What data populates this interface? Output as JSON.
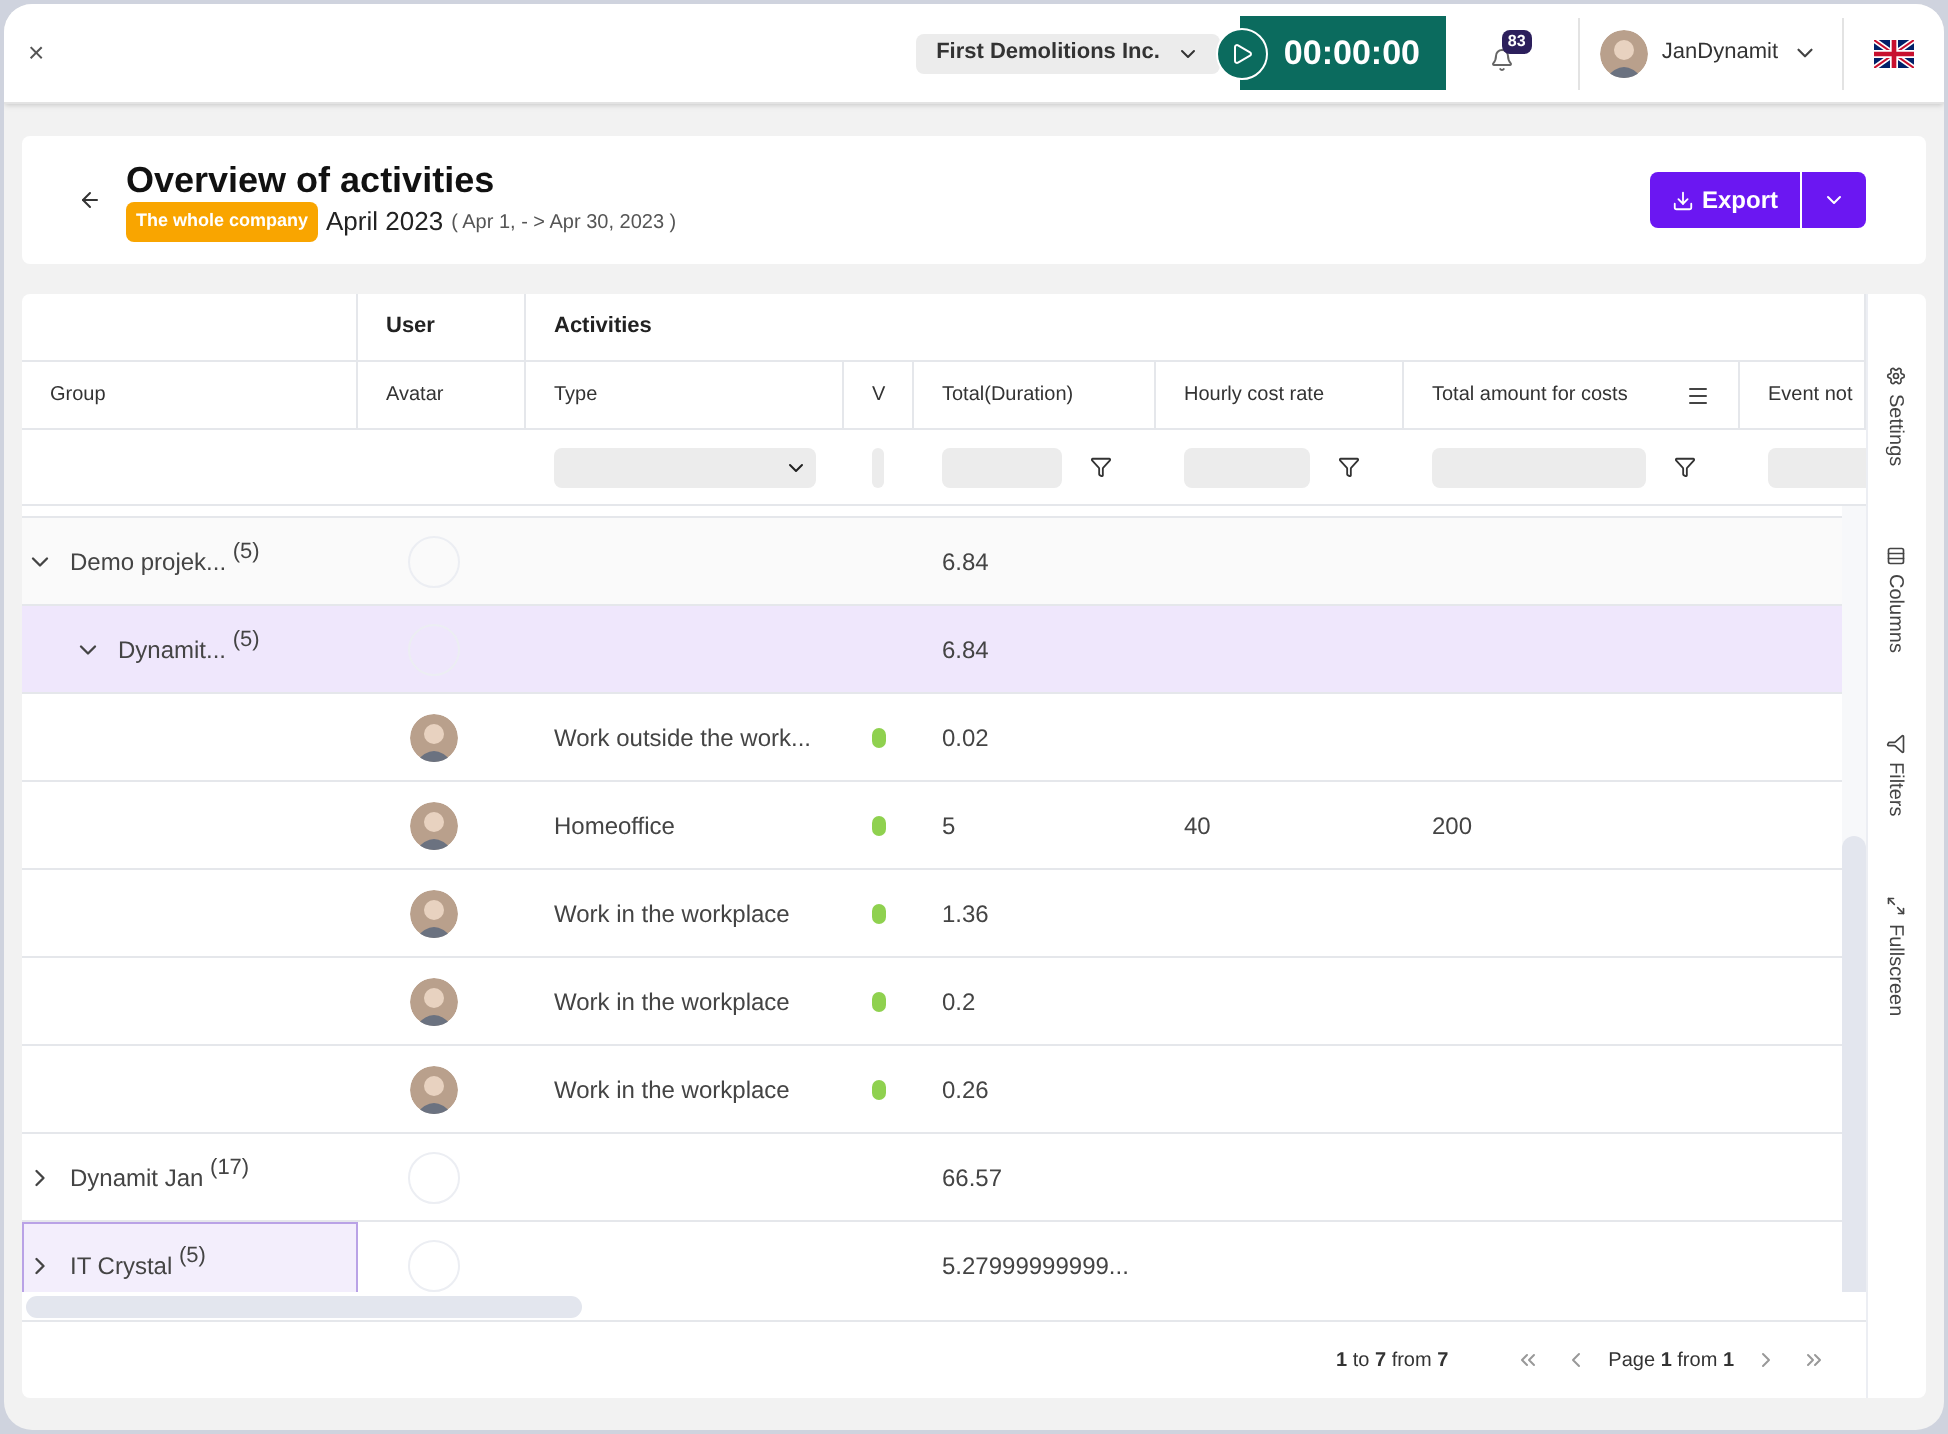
{
  "topbar": {
    "close": "×",
    "company": "First Demolitions Inc.",
    "timer": "00:00:00",
    "notifications": "83",
    "user": "JanDynamit"
  },
  "header": {
    "title": "Overview of activities",
    "scope_badge": "The whole company",
    "period": "April 2023",
    "range": "( Apr 1, - > Apr 30, 2023 )",
    "export": "Export"
  },
  "table": {
    "group_headers": [
      "User",
      "Activities"
    ],
    "columns": [
      "Group",
      "Avatar",
      "Type",
      "V",
      "Total(Duration)",
      "Hourly cost rate",
      "Total amount for costs",
      "Event not"
    ],
    "rows": [
      {
        "kind": "group",
        "label": "Demo projek... $^{(5)}$",
        "total": "6.84",
        "expanded": true,
        "selected": false,
        "focused": false,
        "children": [
          {
            "kind": "group",
            "label": "Dynamit... $^{(5)}$",
            "total": "6.84",
            "expanded": true,
            "selected": true,
            "focused": false,
            "children": [
              {
                "kind": "activity",
                "type": "Work outside the work...",
                "color": "#8fd14f",
                "total": "0.02"
              },
              {
                "kind": "activity",
                "type": "Homeoffice",
                "color": "#8fd14f",
                "total": "5",
                "rate": "40",
                "amount": "200"
              },
              {
                "kind": "activity",
                "type": "Work in the workplace",
                "color": "#8fd14f",
                "total": "1.36"
              },
              {
                "kind": "activity",
                "type": "Work in the workplace",
                "color": "#8fd14f",
                "total": "0.2"
              },
              {
                "kind": "activity",
                "type": "Work in the workplace",
                "color": "#8fd14f",
                "total": "0.26"
              }
            ]
          }
        ]
      },
      {
        "kind": "group",
        "label": "Dynamit Jan $^{(17)}$",
        "total": "66.57",
        "expanded": false,
        "selected": false,
        "focused": false
      },
      {
        "kind": "group",
        "label": "IT Crystal $^{(5)}$",
        "total": "5.27999999999...",
        "expanded": false,
        "selected": false,
        "focused": true
      }
    ]
  },
  "side_panel": [
    "Settings",
    "Columns",
    "Filters",
    "Fullscreen"
  ],
  "pagination": {
    "range_from": "1",
    "range_to_word": "to",
    "range_to": "7",
    "from_word": "from",
    "total": "7",
    "page_word": "Page",
    "page": "1",
    "page_from_word": "from",
    "pages": "1"
  }
}
